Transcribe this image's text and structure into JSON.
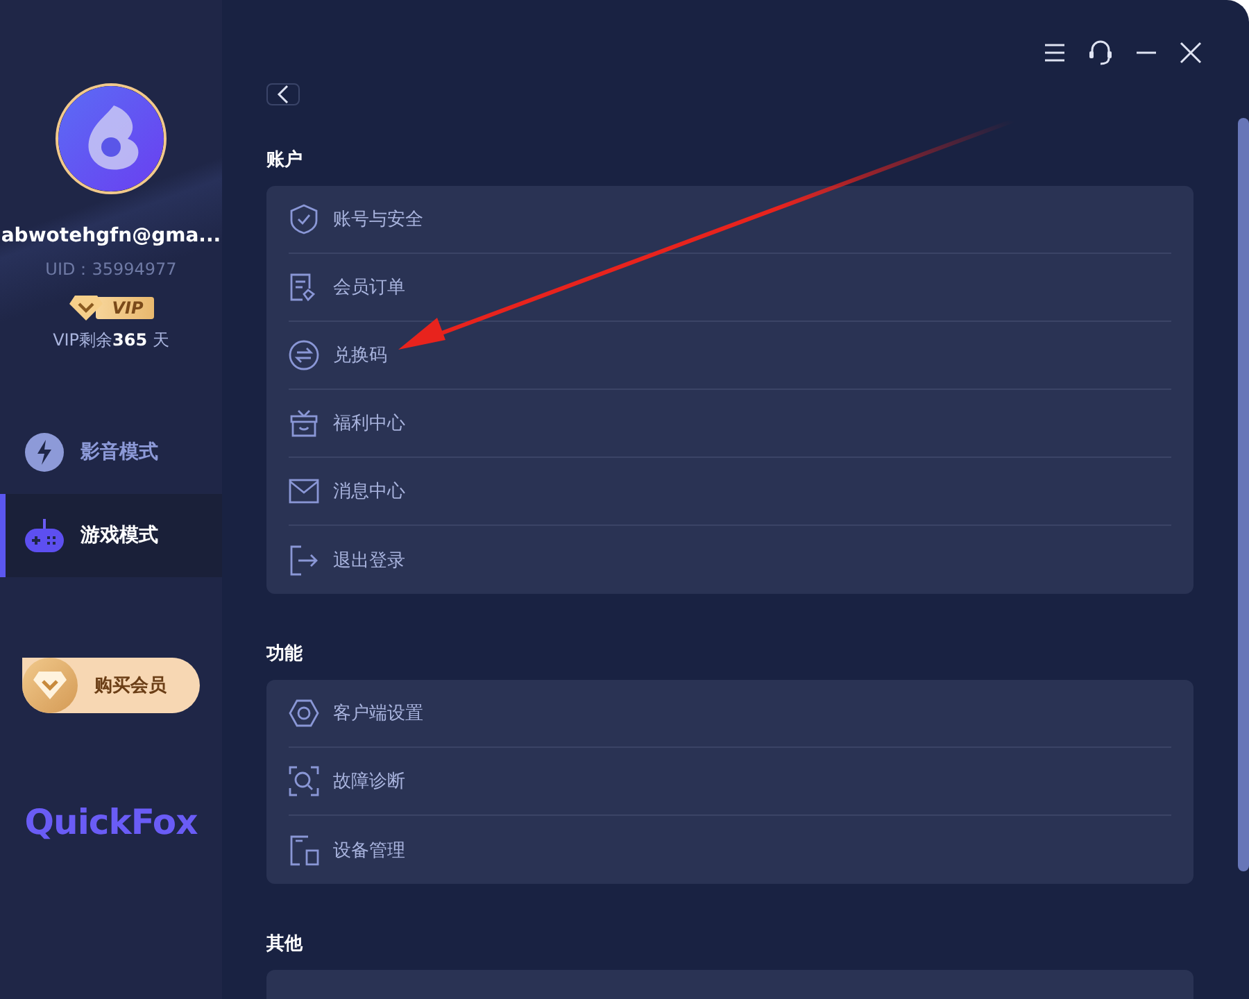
{
  "sidebar": {
    "user": {
      "email": "abwotehgfn@gma...",
      "uid": "UID：35994977",
      "badge": "VIP",
      "vip_remaining": "VIP剩余**365** 天"
    },
    "modes": [
      {
        "label": "影音模式",
        "selected": false
      },
      {
        "label": "游戏模式",
        "selected": true
      }
    ],
    "buy_button": "购买会员",
    "logo": "QuickFox"
  },
  "sections": [
    {
      "title": "账户",
      "items": [
        "账号与安全",
        "会员订单",
        "兑换码",
        "福利中心",
        "消息中心",
        "退出登录"
      ]
    },
    {
      "title": "功能",
      "items": [
        "客户端设置",
        "故障诊断",
        "设备管理"
      ]
    },
    {
      "title": "其他"
    }
  ]
}
